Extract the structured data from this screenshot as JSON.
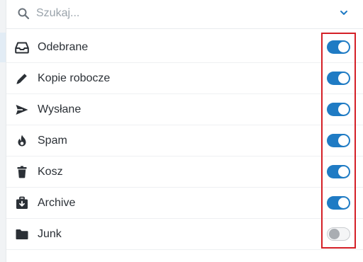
{
  "search": {
    "placeholder": "Szukaj..."
  },
  "folders": [
    {
      "label": "Odebrane",
      "icon": "inbox-icon",
      "enabled": true
    },
    {
      "label": "Kopie robocze",
      "icon": "pencil-icon",
      "enabled": true
    },
    {
      "label": "Wysłane",
      "icon": "send-icon",
      "enabled": true
    },
    {
      "label": "Spam",
      "icon": "fire-icon",
      "enabled": true
    },
    {
      "label": "Kosz",
      "icon": "trash-icon",
      "enabled": true
    },
    {
      "label": "Archive",
      "icon": "archive-icon",
      "enabled": true
    },
    {
      "label": "Junk",
      "icon": "folder-icon",
      "enabled": false
    }
  ],
  "colors": {
    "toggle_on": "#1f7bc4",
    "toggle_off": "#f4f5f6",
    "highlight": "#d42027",
    "icon": "#2b3036"
  }
}
